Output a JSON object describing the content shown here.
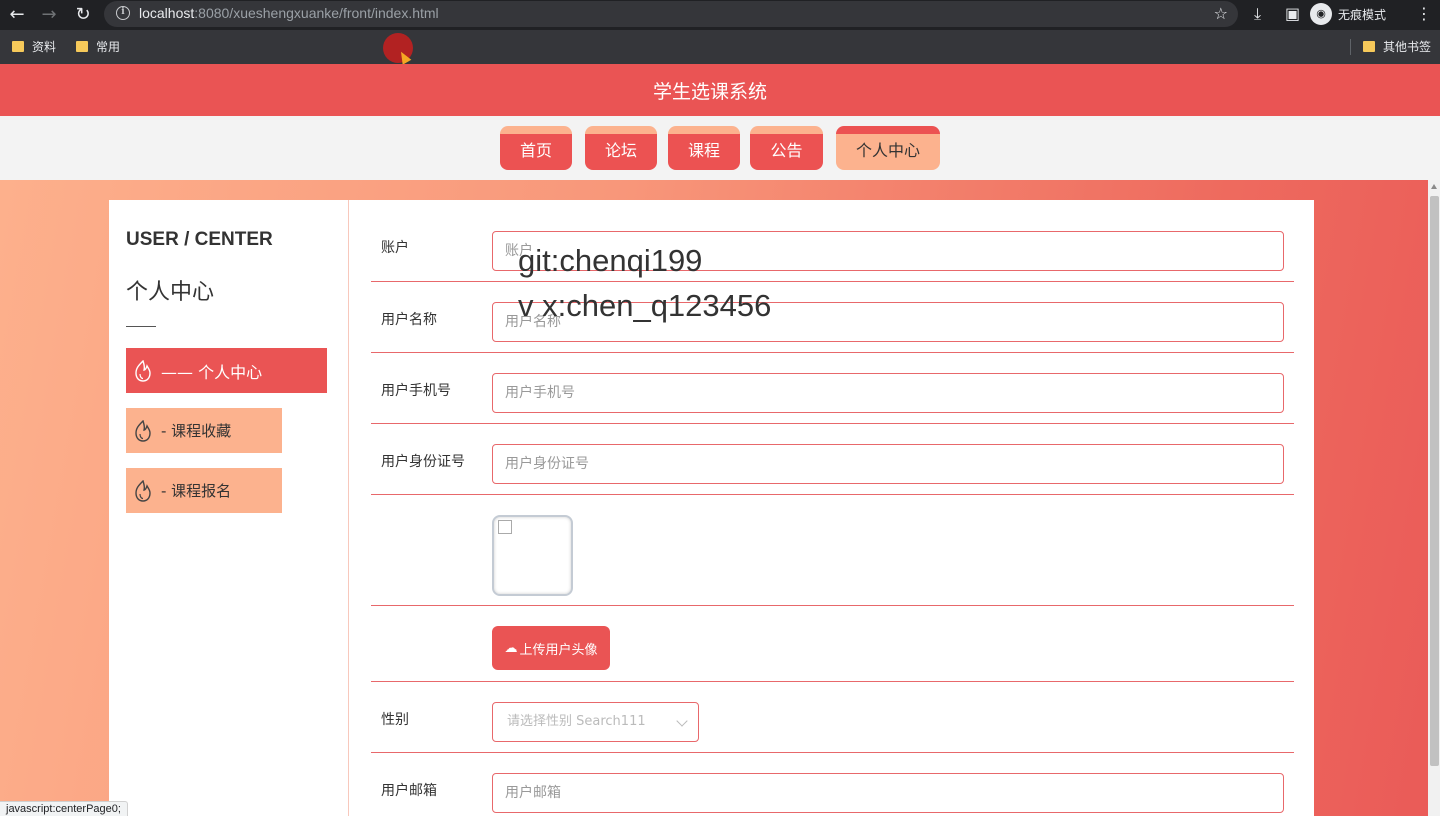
{
  "browser": {
    "url_host": "localhost",
    "url_rest": ":8080/xueshengxuanke/front/index.html",
    "incognito_label": "无痕模式",
    "bookmarks": [
      "资料",
      "常用"
    ],
    "other_bookmarks": "其他书签",
    "status_text": "javascript:centerPage0;"
  },
  "site": {
    "title": "学生选课系统",
    "tabs": [
      {
        "label": "首页",
        "active": false
      },
      {
        "label": "论坛",
        "active": false
      },
      {
        "label": "课程",
        "active": false
      },
      {
        "label": "公告",
        "active": false
      },
      {
        "label": "个人中心",
        "active": true
      }
    ]
  },
  "sidebar": {
    "title_en": "USER / CENTER",
    "title_cn": "个人中心",
    "items": [
      {
        "label": "—— 个人中心",
        "active": true
      },
      {
        "label": "- 课程收藏",
        "active": false
      },
      {
        "label": "- 课程报名",
        "active": false
      }
    ]
  },
  "form": {
    "account": {
      "label": "账户",
      "placeholder": "账户"
    },
    "username": {
      "label": "用户名称",
      "placeholder": "用户名称"
    },
    "phone": {
      "label": "用户手机号",
      "placeholder": "用户手机号"
    },
    "id_card": {
      "label": "用户身份证号",
      "placeholder": "用户身份证号"
    },
    "upload_label": "上传用户头像",
    "gender": {
      "label": "性别",
      "placeholder": "请选择性别 Search111"
    },
    "email": {
      "label": "用户邮箱",
      "placeholder": "用户邮箱"
    }
  },
  "watermark": {
    "line1": "git:chenqi199",
    "line2": "v x:chen_q123456"
  },
  "colors": {
    "primary": "#ea5454",
    "secondary": "#fcb28e"
  }
}
